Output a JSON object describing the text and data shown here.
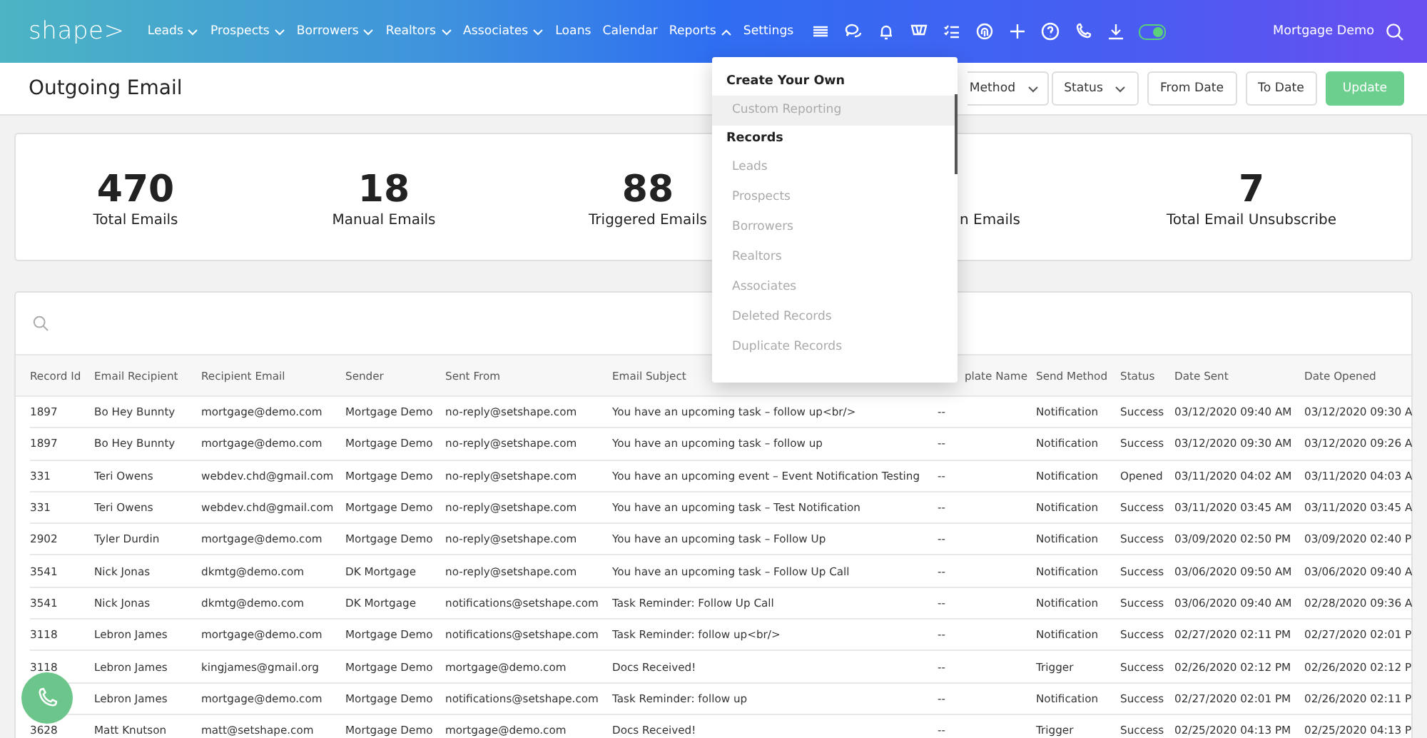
{
  "nav": {
    "logo": "shape>",
    "items": [
      {
        "label": "Leads",
        "kind": "menu",
        "expanded": false
      },
      {
        "label": "Prospects",
        "kind": "menu",
        "expanded": false
      },
      {
        "label": "Borrowers",
        "kind": "menu",
        "expanded": false
      },
      {
        "label": "Realtors",
        "kind": "menu",
        "expanded": false
      },
      {
        "label": "Associates",
        "kind": "menu",
        "expanded": false
      },
      {
        "label": "Loans",
        "kind": "link"
      },
      {
        "label": "Calendar",
        "kind": "link"
      },
      {
        "label": "Reports",
        "kind": "menu",
        "expanded": true
      },
      {
        "label": "Settings",
        "kind": "link"
      }
    ],
    "toggle": {
      "on": true
    },
    "user": "Mortgage Demo"
  },
  "page": {
    "title": "Outgoing Email"
  },
  "filters": [
    {
      "label": "Method",
      "kind": "select"
    },
    {
      "label": "Status",
      "kind": "select"
    },
    {
      "label": "From Date",
      "kind": "button"
    },
    {
      "label": "To Date",
      "kind": "button"
    },
    {
      "label": "Update",
      "kind": "primary"
    }
  ],
  "stats": [
    {
      "value": "470",
      "label": "Total Emails"
    },
    {
      "value": "18",
      "label": "Manual Emails"
    },
    {
      "value": "88",
      "label": "Triggered Emails"
    },
    {
      "label": "n Emails"
    },
    {
      "value": "7",
      "label": "Total Email Unsubscribe"
    }
  ],
  "reports_menu": [
    {
      "label": "Create Your Own",
      "kind": "header"
    },
    {
      "label": "Custom Reporting",
      "kind": "item",
      "selected": true
    },
    {
      "label": "Records",
      "kind": "header"
    },
    {
      "label": "Leads",
      "kind": "item",
      "selected": false
    },
    {
      "label": "Prospects",
      "kind": "item",
      "selected": false
    },
    {
      "label": "Borrowers",
      "kind": "item",
      "selected": false
    },
    {
      "label": "Realtors",
      "kind": "item",
      "selected": false
    },
    {
      "label": "Associates",
      "kind": "item",
      "selected": false
    },
    {
      "label": "Deleted Records",
      "kind": "item",
      "selected": false
    },
    {
      "label": "Duplicate Records",
      "kind": "item",
      "selected": false
    }
  ],
  "table": {
    "columns": [
      "Record Id",
      "Email Recipient",
      "Recipient Email",
      "Sender",
      "Sent From",
      "Email Subject",
      "plate Name",
      "Send Method",
      "Status",
      "Date Sent",
      "Date Opened"
    ],
    "rows": [
      [
        "1897",
        "Bo Hey Bunnty",
        "mortgage@demo.com",
        "Mortgage Demo",
        "no-reply@setshape.com",
        "You have an upcoming task – follow up<br/>",
        "--",
        "Notification",
        "Success",
        "03/12/2020 09:40 AM",
        "03/12/2020 09:30 A"
      ],
      [
        "1897",
        "Bo Hey Bunnty",
        "mortgage@demo.com",
        "Mortgage Demo",
        "no-reply@setshape.com",
        "You have an upcoming task – follow up",
        "--",
        "Notification",
        "Success",
        "03/12/2020 09:30 AM",
        "03/12/2020 09:26 A"
      ],
      [
        "331",
        "Teri Owens",
        "webdev.chd@gmail.com",
        "Mortgage Demo",
        "no-reply@setshape.com",
        "You have an upcoming event – Event Notification Testing",
        "--",
        "Notification",
        "Opened",
        "03/11/2020 04:02 AM",
        "03/11/2020 04:03 A"
      ],
      [
        "331",
        "Teri Owens",
        "webdev.chd@gmail.com",
        "Mortgage Demo",
        "no-reply@setshape.com",
        "You have an upcoming task – Test Notification",
        "--",
        "Notification",
        "Success",
        "03/11/2020 03:45 AM",
        "03/11/2020 03:45 A"
      ],
      [
        "2902",
        "Tyler Durdin",
        "mortgage@demo.com",
        "Mortgage Demo",
        "no-reply@setshape.com",
        "You have an upcoming task – Follow Up",
        "--",
        "Notification",
        "Success",
        "03/09/2020 02:50 PM",
        "03/09/2020 02:40 P"
      ],
      [
        "3541",
        "Nick Jonas",
        "dkmtg@demo.com",
        "DK Mortgage",
        "no-reply@setshape.com",
        "You have an upcoming task – Follow Up Call",
        "--",
        "Notification",
        "Success",
        "03/06/2020 09:50 AM",
        "03/06/2020 09:40 A"
      ],
      [
        "3541",
        "Nick Jonas",
        "dkmtg@demo.com",
        "DK Mortgage",
        "notifications@setshape.com",
        "Task Reminder: Follow Up Call",
        "--",
        "Notification",
        "Success",
        "03/06/2020 09:40 AM",
        "02/28/2020 09:36 A"
      ],
      [
        "3118",
        "Lebron James",
        "mortgage@demo.com",
        "Mortgage Demo",
        "notifications@setshape.com",
        "Task Reminder: follow up<br/>",
        "--",
        "Notification",
        "Success",
        "02/27/2020 02:11 PM",
        "02/27/2020 02:01 P"
      ],
      [
        "3118",
        "Lebron James",
        "kingjames@gmail.org",
        "Mortgage Demo",
        "mortgage@demo.com",
        "Docs Received!",
        "--",
        "Trigger",
        "Success",
        "02/26/2020 02:12 PM",
        "02/26/2020 02:12 P"
      ],
      [
        "",
        "Lebron James",
        "mortgage@demo.com",
        "Mortgage Demo",
        "notifications@setshape.com",
        "Task Reminder: follow up",
        "--",
        "Notification",
        "Success",
        "02/27/2020 02:01 PM",
        "02/26/2020 02:11 P"
      ],
      [
        "3628",
        "Matt Knutson",
        "matt@setshape.com",
        "Mortgage Demo",
        "mortgage@demo.com",
        "Docs Received!",
        "--",
        "Trigger",
        "Success",
        "02/25/2020 04:13 PM",
        "02/25/2020 04:13 P"
      ]
    ]
  }
}
